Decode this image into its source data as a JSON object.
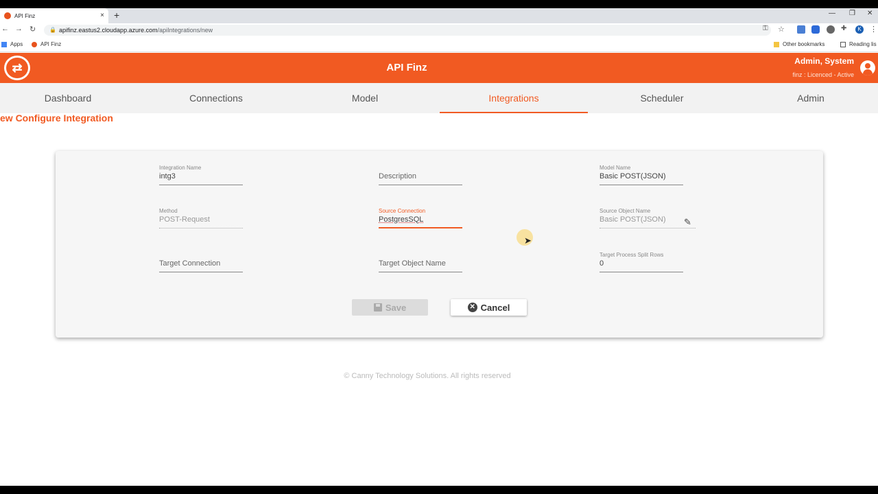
{
  "browser": {
    "tab_title": "API Finz",
    "new_tab": "+",
    "tab_close": "×",
    "url_host": "apifinz.eastus2.cloudapp.azure.com",
    "url_path": "/apiIntegrations/new",
    "bookmarks": {
      "apps": "Apps",
      "api_finz": "API Finz",
      "other": "Other bookmarks",
      "reading": "Reading lis"
    },
    "profile_initial": "K"
  },
  "header": {
    "title": "API Finz",
    "user_name": "Admin, System",
    "user_status": "finz : Licenced - Active"
  },
  "nav": {
    "tabs": [
      {
        "label": "Dashboard"
      },
      {
        "label": "Connections"
      },
      {
        "label": "Model"
      },
      {
        "label": "Integrations"
      },
      {
        "label": "Scheduler"
      },
      {
        "label": "Admin"
      }
    ],
    "active": "Integrations"
  },
  "page": {
    "title": "ew Configure Integration"
  },
  "form": {
    "integration_name": {
      "label": "Integration Name",
      "value": "intg3"
    },
    "description": {
      "placeholder": "Description"
    },
    "model_name": {
      "label": "Model Name",
      "value": "Basic POST(JSON)"
    },
    "method": {
      "label": "Method",
      "value": "POST-Request"
    },
    "source_connection": {
      "label": "Source Connection",
      "value": "PostgresSQL"
    },
    "source_object_name": {
      "label": "Source Object Name",
      "value": "Basic POST(JSON)"
    },
    "target_connection": {
      "placeholder": "Target Connection"
    },
    "target_object_name": {
      "placeholder": "Target Object Name"
    },
    "target_split_rows": {
      "label": "Target Process Split Rows",
      "value": "0"
    },
    "save_label": "Save",
    "cancel_label": "Cancel"
  },
  "footer": {
    "text": "© Canny Technology Solutions. All rights reserved"
  },
  "colors": {
    "brand": "#f15a22"
  }
}
